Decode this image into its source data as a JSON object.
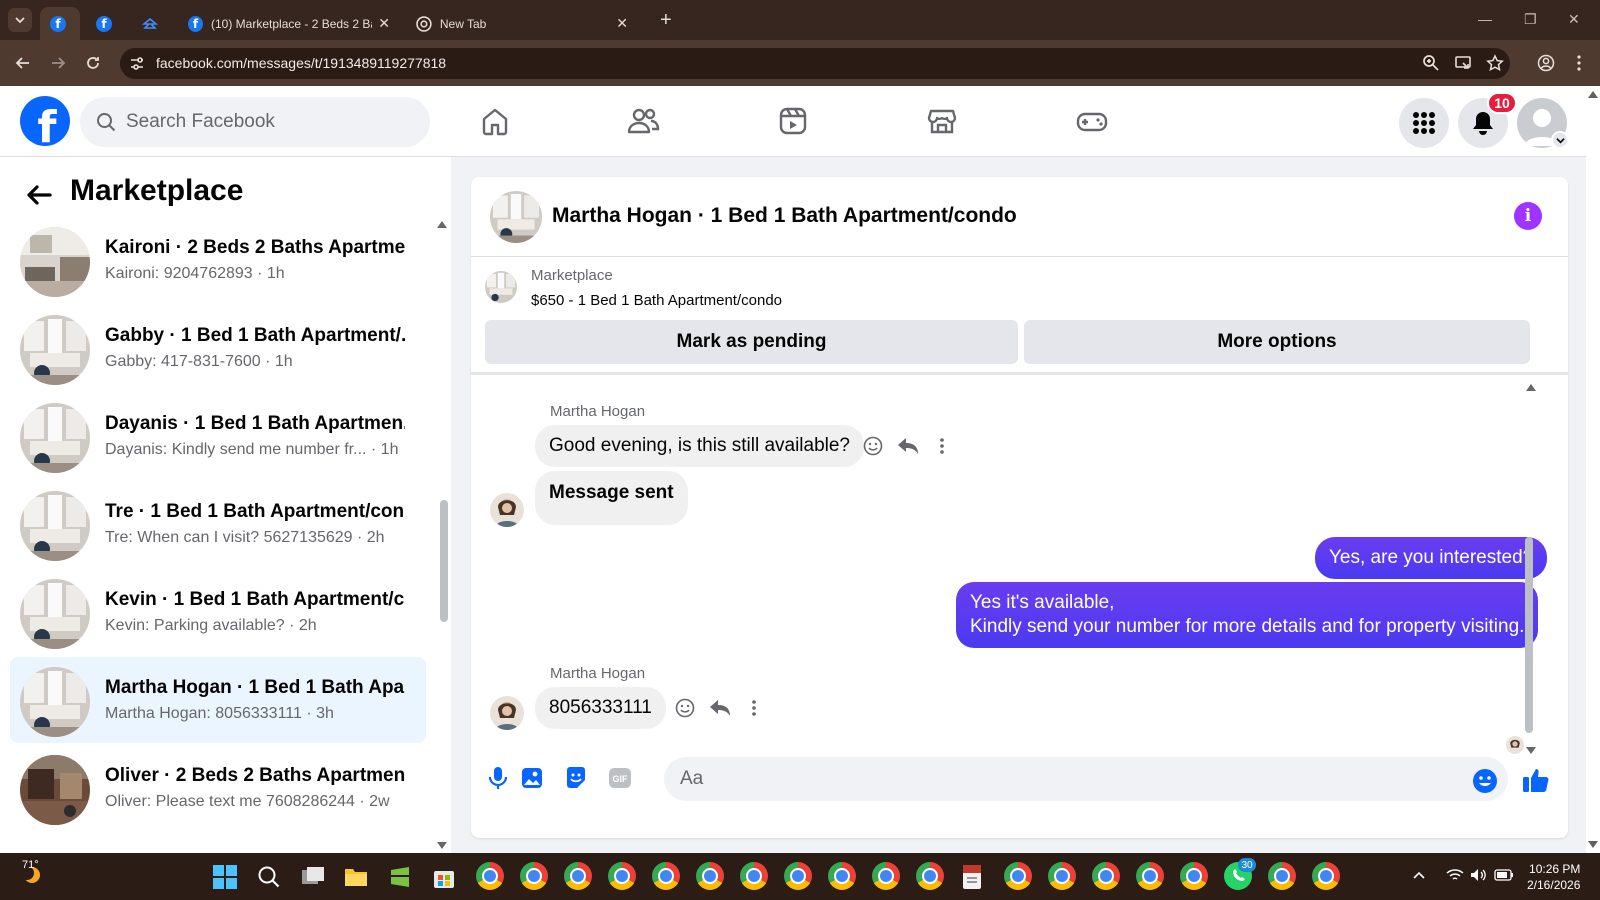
{
  "browser": {
    "tabs": [
      {
        "title": "",
        "active": true
      },
      {
        "title": ""
      },
      {
        "title": ""
      },
      {
        "title": "(10) Marketplace - 2 Beds 2 Bat"
      },
      {
        "title": "New Tab"
      }
    ],
    "url": "facebook.com/messages/t/1913489119277818"
  },
  "header": {
    "search_placeholder": "Search Facebook",
    "notification_count": "10"
  },
  "left": {
    "title": "Marketplace",
    "conversations": [
      {
        "name": "Kaironi · 2 Beds 2 Baths Apartme...",
        "preview": "Kaironi: 9204762893 · 1h"
      },
      {
        "name": "Gabby · 1 Bed 1 Bath Apartment/...",
        "preview": "Gabby: 417-831-7600 · 1h"
      },
      {
        "name": "Dayanis · 1 Bed 1 Bath Apartmen...",
        "preview": "Dayanis: Kindly send me number fr...  · 1h"
      },
      {
        "name": "Tre · 1 Bed 1 Bath Apartment/con...",
        "preview": "Tre: When can I visit? 5627135629 · 2h"
      },
      {
        "name": "Kevin · 1 Bed 1 Bath Apartment/c...",
        "preview": "Kevin: Parking available? · 2h"
      },
      {
        "name": "Martha Hogan · 1 Bed 1 Bath Apa...",
        "preview": "Martha Hogan: 8056333111 · 3h",
        "selected": true
      },
      {
        "name": "Oliver · 2 Beds 2 Baths Apartmen...",
        "preview": "Oliver: Please text me 7608286244 · 2w"
      }
    ]
  },
  "chat": {
    "title": "Martha Hogan · 1 Bed 1 Bath Apartment/condo",
    "marketplace_label": "Marketplace",
    "listing": "$650 - 1 Bed 1 Bath Apartment/condo",
    "mark_pending": "Mark as pending",
    "more_options": "More options",
    "sender1": "Martha Hogan",
    "msg1": "Good evening, is this still available?",
    "msg2": "Message sent",
    "msg3": "Yes, are you interested?",
    "msg4_line1": "Yes it's available,",
    "msg4_line2": "Kindly send your number for more details and for property visiting.",
    "sender2": "Martha Hogan",
    "msg5": "8056333111",
    "input_placeholder": "Aa"
  },
  "taskbar": {
    "weather": "71°",
    "time": "10:26 PM",
    "date": "2/16/2026",
    "whatsapp_badge": "30"
  },
  "colors": {
    "facebook_blue": "#0866ff",
    "outgoing_bubble": "#5b3aee",
    "selected_row": "#ebf5ff",
    "badge_red": "#e41e3f"
  }
}
